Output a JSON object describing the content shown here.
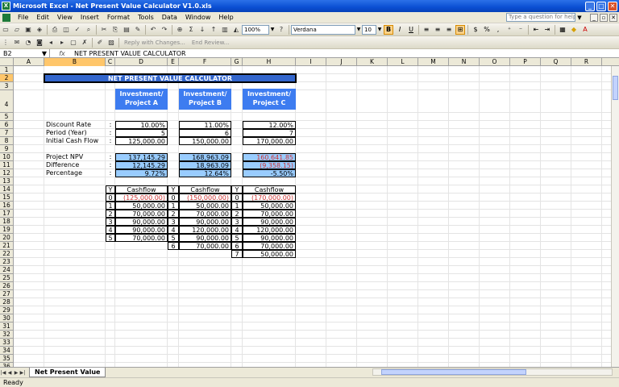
{
  "window": {
    "title": "Microsoft Excel - Net Present Value Calculator V1.0.xls",
    "minimize": "_",
    "maximize": "□",
    "close": "✕"
  },
  "menu": {
    "items": [
      "File",
      "Edit",
      "View",
      "Insert",
      "Format",
      "Tools",
      "Data",
      "Window",
      "Help"
    ],
    "help_placeholder": "Type a question for help"
  },
  "toolbar": {
    "zoom": "100%",
    "font": "Verdana",
    "size": "10",
    "reply_text": "Reply with Changes...",
    "end_review": "End Review..."
  },
  "formula": {
    "name_box": "B2",
    "fx": "fx",
    "content": "NET PRESENT VALUE CALCULATOR"
  },
  "columns": [
    "A",
    "B",
    "C",
    "D",
    "E",
    "F",
    "G",
    "H",
    "I",
    "J",
    "K",
    "L",
    "M",
    "N",
    "O",
    "P",
    "Q",
    "R"
  ],
  "rows": [
    "1",
    "2",
    "3",
    "4",
    "5",
    "6",
    "7",
    "8",
    "9",
    "10",
    "11",
    "12",
    "13",
    "14",
    "15",
    "16",
    "17",
    "18",
    "19",
    "20",
    "21",
    "22",
    "23",
    "24",
    "25",
    "26",
    "27",
    "28",
    "29",
    "30",
    "31",
    "32",
    "33",
    "34",
    "35",
    "36"
  ],
  "sheet": {
    "title": "NET PRESENT VALUE CALCULATOR",
    "projects": [
      {
        "head1": "Investment/",
        "head2": "Project A",
        "rate": "10.00%",
        "period": "5",
        "initial": "125,000.00",
        "npv": "137,145.29",
        "difference": "12,145.29",
        "percentage": "9.72%"
      },
      {
        "head1": "Investment/",
        "head2": "Project B",
        "rate": "11.00%",
        "period": "6",
        "initial": "150,000.00",
        "npv": "168,963.09",
        "difference": "18,963.09",
        "percentage": "12.64%"
      },
      {
        "head1": "Investment/",
        "head2": "Project C",
        "rate": "12.00%",
        "period": "7",
        "initial": "170,000.00",
        "npv": "160,641.85",
        "difference": "(9,358.15)",
        "percentage": "-5.50%"
      }
    ],
    "labels": {
      "rate": "Discount Rate",
      "period": "Period (Year)",
      "initial": "Initial Cash Flow",
      "npv": "Project NPV",
      "difference": "Difference",
      "percentage": "Percentage",
      "colon": ":"
    },
    "cashflow_headers": {
      "y": "Y",
      "cashflow": "Cashflow"
    },
    "cashflows_a": [
      [
        "0",
        "(125,000.00)"
      ],
      [
        "1",
        "50,000.00"
      ],
      [
        "2",
        "70,000.00"
      ],
      [
        "3",
        "90,000.00"
      ],
      [
        "4",
        "90,000.00"
      ],
      [
        "5",
        "70,000.00"
      ]
    ],
    "cashflows_b": [
      [
        "0",
        "(150,000.00)"
      ],
      [
        "1",
        "50,000.00"
      ],
      [
        "2",
        "70,000.00"
      ],
      [
        "3",
        "90,000.00"
      ],
      [
        "4",
        "120,000.00"
      ],
      [
        "5",
        "90,000.00"
      ],
      [
        "6",
        "70,000.00"
      ]
    ],
    "cashflows_c": [
      [
        "0",
        "(170,000.00)"
      ],
      [
        "1",
        "50,000.00"
      ],
      [
        "2",
        "70,000.00"
      ],
      [
        "3",
        "90,000.00"
      ],
      [
        "4",
        "120,000.00"
      ],
      [
        "5",
        "90,000.00"
      ],
      [
        "6",
        "70,000.00"
      ],
      [
        "7",
        "50,000.00"
      ]
    ]
  },
  "tabs": {
    "active": "Net Present Value"
  },
  "status": {
    "text": "Ready"
  }
}
